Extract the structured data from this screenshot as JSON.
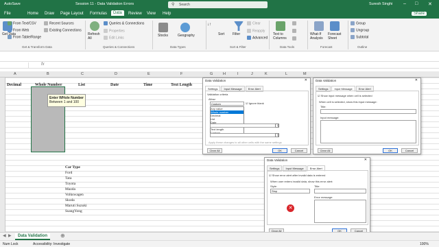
{
  "titlebar": {
    "autosave": "AutoSave",
    "doc": "Session 11 - Data Validation Errors",
    "search": "Search",
    "user": "Suresh Singhi"
  },
  "tabs": [
    "File",
    "Home",
    "Draw",
    "Page Layout",
    "Formulas",
    "Data",
    "Review",
    "View",
    "Help"
  ],
  "share": "Share",
  "ribbon": {
    "get_data": "Get Data",
    "from_text": "From Text/CSV",
    "from_web": "From Web",
    "from_table": "From Table/Range",
    "recent": "Recent Sources",
    "existing": "Existing Connections",
    "refresh": "Refresh All",
    "queries": "Queries & Connections",
    "properties": "Properties",
    "edit_links": "Edit Links",
    "stocks": "Stocks",
    "geography": "Geography",
    "sort": "Sort",
    "filter": "Filter",
    "clear": "Clear",
    "reapply": "Reapply",
    "advanced": "Advanced",
    "text_to_cols": "Text to Columns",
    "what_if": "What-If Analysis",
    "forecast": "Forecast Sheet",
    "group": "Group",
    "ungroup": "Ungroup",
    "subtotal": "Subtotal",
    "groups": [
      "Get & Transform Data",
      "Queries & Connections",
      "Data Types",
      "Sort & Filter",
      "Data Tools",
      "Forecast",
      "Outline"
    ]
  },
  "columns": [
    "A",
    "B",
    "C",
    "D",
    "E",
    "F",
    "G",
    "H",
    "I",
    "J",
    "K",
    "L",
    "M",
    "N",
    "O",
    "P",
    "Q",
    "R",
    "S",
    "T"
  ],
  "headers": [
    "Decimal",
    "Whole Number",
    "List",
    "Date",
    "Time",
    "Text Length"
  ],
  "input_tip": {
    "title": "Enter WHole Number",
    "body": "Between 1 and 100"
  },
  "car_header": "Car Type",
  "cars": [
    "Ford",
    "Tata",
    "Toyota",
    "Mazda",
    "Volkswagen",
    "Skoda",
    "Maruti Suzuki",
    "SsangYong"
  ],
  "sheet_tab": "Data Validation",
  "status": {
    "num_lock": "Num Lock",
    "accessibility": "Accessibility: Investigate",
    "zoom": "100%"
  },
  "dlg1": {
    "title": "Data Validation",
    "tabs": [
      "Settings",
      "Input Message",
      "Error Alert"
    ],
    "criteria": "Validation criteria",
    "allow": "Allow:",
    "allow_value": "Custom",
    "ignore_blank": "Ignore blank",
    "options": [
      "Any value",
      "Whole number",
      "Decimal",
      "List",
      "Date",
      "Time",
      "Text length",
      "Custom"
    ],
    "apply": "Apply these changes to all other cells with the same settings",
    "clear": "Clear All",
    "ok": "OK",
    "cancel": "Cancel"
  },
  "dlg2": {
    "title": "Data Validation",
    "tabs": [
      "Settings",
      "Input Message",
      "Error Alert"
    ],
    "show": "Show input message when cell is selected",
    "when": "When cell is selected, show this input message:",
    "title_lbl": "Title:",
    "msg_lbl": "Input message:",
    "clear": "Clear All",
    "ok": "OK",
    "cancel": "Cancel"
  },
  "dlg3": {
    "title": "Data Validation",
    "tabs": [
      "Settings",
      "Input Message",
      "Error Alert"
    ],
    "show": "Show error alert after invalid data is entered",
    "when": "When user enters invalid data, show this error alert:",
    "style_lbl": "Style:",
    "style_val": "Stop",
    "title_lbl": "Title:",
    "msg_lbl": "Error message:",
    "clear": "Clear All",
    "ok": "OK",
    "cancel": "Cancel"
  },
  "colors": {
    "excel_green": "#217346",
    "selection": "#b9b9b9",
    "tip_bg": "#ffffe1",
    "stop_red": "#d9262b",
    "highlight": "#0078d7"
  }
}
